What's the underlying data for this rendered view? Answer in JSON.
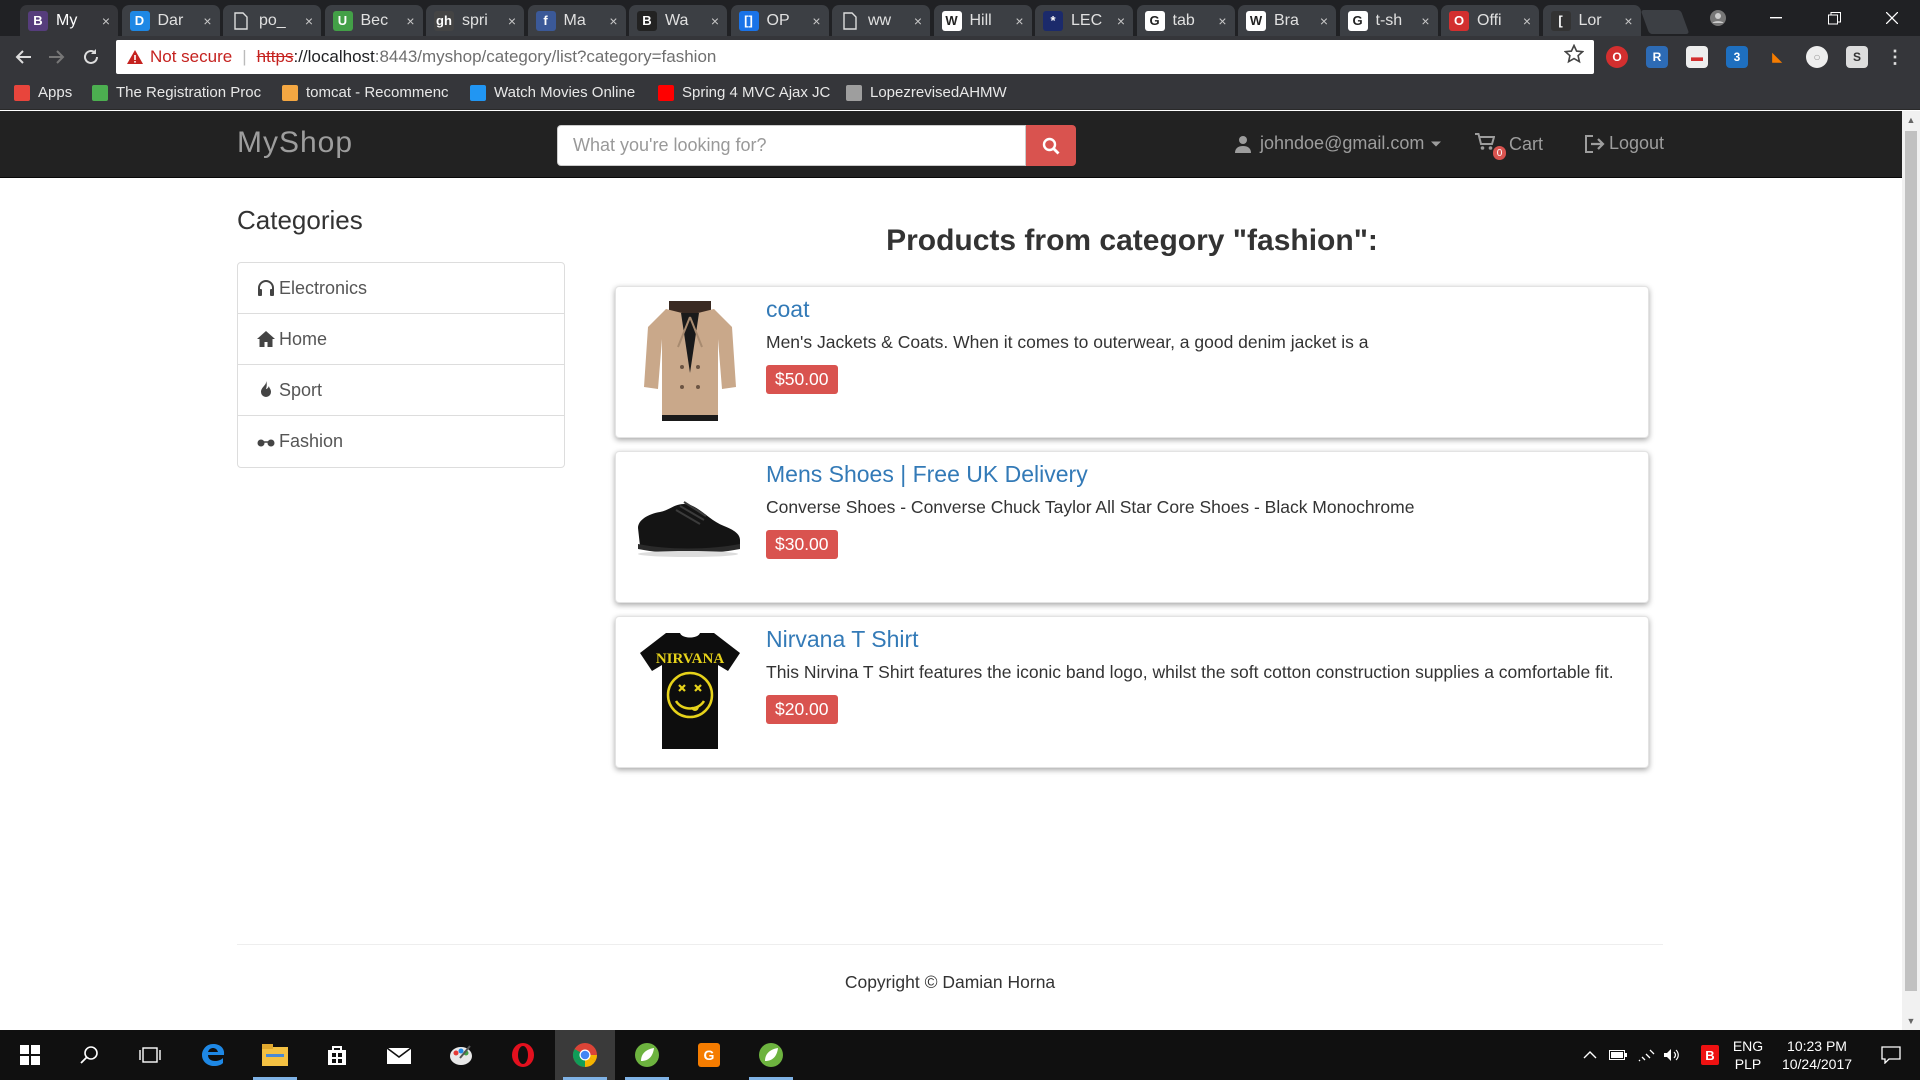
{
  "browser": {
    "tabs": [
      {
        "title": "My",
        "fav": "B",
        "color": "#563d7c",
        "active": true
      },
      {
        "title": "Dar",
        "fav": "D",
        "color": "#1e88e5"
      },
      {
        "title": "po_",
        "fav": "doc"
      },
      {
        "title": "Bec",
        "fav": "U",
        "color": "#43a047"
      },
      {
        "title": "spri",
        "fav": "gh",
        "color": "#444"
      },
      {
        "title": "Ma",
        "fav": "f",
        "color": "#3b5998"
      },
      {
        "title": "Wa",
        "fav": "B",
        "color": "#222"
      },
      {
        "title": "OP",
        "fav": "[]",
        "color": "#1a73e8"
      },
      {
        "title": "ww",
        "fav": "doc"
      },
      {
        "title": "Hill",
        "fav": "W",
        "color": "#fff"
      },
      {
        "title": "LEC",
        "fav": "*",
        "color": "#1b2a6b"
      },
      {
        "title": "tab",
        "fav": "G",
        "color": "#fff"
      },
      {
        "title": "Bra",
        "fav": "W",
        "color": "#fff"
      },
      {
        "title": "t-sh",
        "fav": "G",
        "color": "#fff"
      },
      {
        "title": "Offi",
        "fav": "O",
        "color": "#d32f2f"
      },
      {
        "title": "Lor",
        "fav": "[",
        "color": "#333"
      }
    ],
    "tab_close": "×",
    "address": {
      "warning": "Not secure",
      "scheme": "https",
      "host": "://localhost",
      "path": ":8443/myshop/category/list?category=fashion"
    },
    "bookmarks": [
      {
        "label": "Apps",
        "color": "#e8453c"
      },
      {
        "label": "The Registration Proc",
        "color": "#4caf50"
      },
      {
        "label": "tomcat - Recommenc",
        "color": "#f4a742"
      },
      {
        "label": "Watch Movies Online",
        "color": "#2196f3"
      },
      {
        "label": "Spring 4 MVC Ajax JC",
        "color": "#ff0000"
      },
      {
        "label": "LopezrevisedAHMW",
        "color": "#9e9e9e"
      }
    ]
  },
  "navbar": {
    "brand": "MyShop",
    "search_placeholder": "What you're looking for?",
    "user": "johndoe@gmail.com",
    "cart_label": "Cart",
    "cart_count": "0",
    "logout_label": "Logout"
  },
  "sidebar": {
    "title": "Categories",
    "items": [
      {
        "label": "Electronics",
        "icon": "headphones-icon"
      },
      {
        "label": "Home",
        "icon": "home-icon"
      },
      {
        "label": "Sport",
        "icon": "fire-icon"
      },
      {
        "label": "Fashion",
        "icon": "sunglasses-icon"
      }
    ]
  },
  "main": {
    "heading": "Products from category \"fashion\":",
    "products": [
      {
        "title": "coat",
        "description": "Men's Jackets & Coats. When it comes to outerwear, a good denim jacket is a",
        "price": "$50.00",
        "image": "coat-image"
      },
      {
        "title": "Mens Shoes | Free UK Delivery",
        "description": "Converse Shoes - Converse Chuck Taylor All Star Core Shoes - Black Monochrome",
        "price": "$30.00",
        "image": "shoe-image"
      },
      {
        "title": "Nirvana T Shirt",
        "description": "This Nirvina T Shirt features the iconic band logo, whilst the soft cotton construction supplies a comfortable fit.",
        "price": "$20.00",
        "image": "tshirt-image",
        "shirt_text": "NIRVANA"
      }
    ]
  },
  "footer": {
    "copyright": "Copyright © Damian Horna"
  },
  "taskbar": {
    "language": "ENG",
    "layout": "PLP",
    "time": "10:23 PM",
    "date": "10/24/2017"
  },
  "colors": {
    "accent_danger": "#d9534f",
    "link": "#337ab7",
    "navbar_bg": "#222222"
  }
}
